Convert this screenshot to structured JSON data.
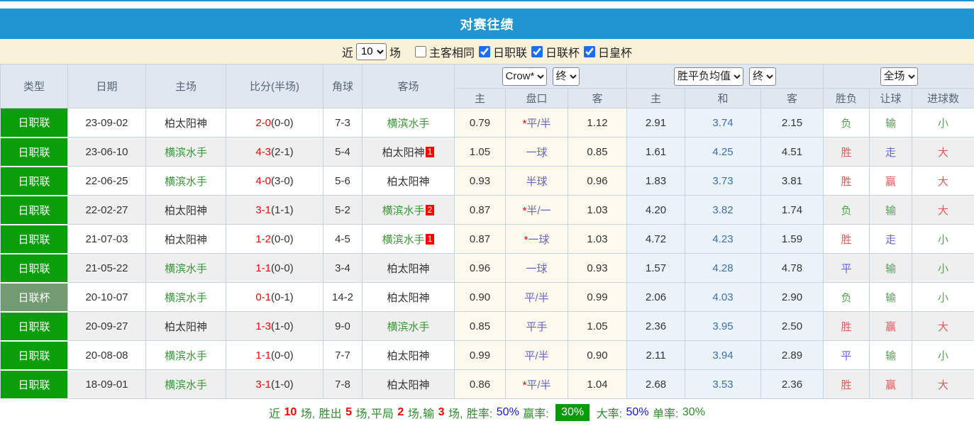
{
  "title": "对赛往绩",
  "filter": {
    "recent_label": "近",
    "recent_value": "10",
    "games_label": "场",
    "same_hva_label": "主客相同",
    "leagues": [
      "日职联",
      "日联杯",
      "日皇杯"
    ]
  },
  "header": {
    "col_type": "类型",
    "col_date": "日期",
    "col_home": "主场",
    "col_score": "比分(半场)",
    "col_corner": "角球",
    "col_away": "客场",
    "odds_select": "Crow*",
    "odds_state_select": "终",
    "mean_select": "胜平负均值",
    "mean_state_select": "终",
    "result_select": "全场",
    "sub": {
      "home": "主",
      "handicap": "盘口",
      "away": "客",
      "mean_home": "主",
      "mean_draw": "和",
      "mean_away": "客",
      "wl": "胜负",
      "hcp_result": "让球",
      "goals": "进球数"
    }
  },
  "rows": [
    {
      "league": "日职联",
      "league_c": "j1",
      "date": "23-09-02",
      "home": "柏太阳神",
      "home_c": "dark",
      "home_card": "",
      "score": "2-0",
      "half": "(0-0)",
      "corner": "7-3",
      "away": "横滨水手",
      "away_c": "green",
      "away_card": "",
      "odd_home": "0.79",
      "star": "*",
      "handicap": "平/半",
      "odd_away": "1.12",
      "mean_home": "2.91",
      "mean_draw": "3.74",
      "mean_away": "2.15",
      "wl": "负",
      "wl_c": "g",
      "hcp": "输",
      "hcp_c": "g",
      "goal": "小",
      "goal_c": "g"
    },
    {
      "league": "日职联",
      "league_c": "j1",
      "date": "23-06-10",
      "home": "横滨水手",
      "home_c": "green",
      "home_card": "",
      "score": "4-3",
      "half": "(2-1)",
      "corner": "5-4",
      "away": "柏太阳神",
      "away_c": "dark",
      "away_card": "1",
      "odd_home": "1.05",
      "star": "",
      "handicap": "一球",
      "odd_away": "0.85",
      "mean_home": "1.61",
      "mean_draw": "4.25",
      "mean_away": "4.51",
      "wl": "胜",
      "wl_c": "r",
      "hcp": "走",
      "hcp_c": "b",
      "goal": "大",
      "goal_c": "r"
    },
    {
      "league": "日职联",
      "league_c": "j1",
      "date": "22-06-25",
      "home": "横滨水手",
      "home_c": "green",
      "home_card": "",
      "score": "4-0",
      "half": "(3-0)",
      "corner": "5-6",
      "away": "柏太阳神",
      "away_c": "dark",
      "away_card": "",
      "odd_home": "0.93",
      "star": "",
      "handicap": "半球",
      "odd_away": "0.96",
      "mean_home": "1.83",
      "mean_draw": "3.73",
      "mean_away": "3.81",
      "wl": "胜",
      "wl_c": "r",
      "hcp": "赢",
      "hcp_c": "r",
      "goal": "大",
      "goal_c": "r"
    },
    {
      "league": "日职联",
      "league_c": "j1",
      "date": "22-02-27",
      "home": "柏太阳神",
      "home_c": "dark",
      "home_card": "",
      "score": "3-1",
      "half": "(1-1)",
      "corner": "5-2",
      "away": "横滨水手",
      "away_c": "green",
      "away_card": "2",
      "odd_home": "0.87",
      "star": "*",
      "handicap": "半/一",
      "odd_away": "1.03",
      "mean_home": "4.20",
      "mean_draw": "3.82",
      "mean_away": "1.74",
      "wl": "负",
      "wl_c": "g",
      "hcp": "输",
      "hcp_c": "g",
      "goal": "大",
      "goal_c": "r"
    },
    {
      "league": "日职联",
      "league_c": "j1",
      "date": "21-07-03",
      "home": "柏太阳神",
      "home_c": "dark",
      "home_card": "",
      "score": "1-2",
      "half": "(0-0)",
      "corner": "4-5",
      "away": "横滨水手",
      "away_c": "green",
      "away_card": "1",
      "odd_home": "0.87",
      "star": "*",
      "handicap": "一球",
      "odd_away": "1.03",
      "mean_home": "4.72",
      "mean_draw": "4.23",
      "mean_away": "1.59",
      "wl": "胜",
      "wl_c": "r",
      "hcp": "走",
      "hcp_c": "b",
      "goal": "小",
      "goal_c": "g"
    },
    {
      "league": "日职联",
      "league_c": "j1",
      "date": "21-05-22",
      "home": "横滨水手",
      "home_c": "green",
      "home_card": "",
      "score": "1-1",
      "half": "(0-0)",
      "corner": "3-4",
      "away": "柏太阳神",
      "away_c": "dark",
      "away_card": "",
      "odd_home": "0.96",
      "star": "",
      "handicap": "一球",
      "odd_away": "0.93",
      "mean_home": "1.57",
      "mean_draw": "4.28",
      "mean_away": "4.78",
      "wl": "平",
      "wl_c": "b",
      "hcp": "输",
      "hcp_c": "g",
      "goal": "小",
      "goal_c": "g"
    },
    {
      "league": "日联杯",
      "league_c": "cup",
      "date": "20-10-07",
      "home": "横滨水手",
      "home_c": "green",
      "home_card": "",
      "score": "0-1",
      "half": "(0-1)",
      "corner": "14-2",
      "away": "柏太阳神",
      "away_c": "dark",
      "away_card": "",
      "odd_home": "0.90",
      "star": "",
      "handicap": "平/半",
      "odd_away": "0.99",
      "mean_home": "2.06",
      "mean_draw": "4.03",
      "mean_away": "2.90",
      "wl": "负",
      "wl_c": "g",
      "hcp": "输",
      "hcp_c": "g",
      "goal": "小",
      "goal_c": "g"
    },
    {
      "league": "日职联",
      "league_c": "j1",
      "date": "20-09-27",
      "home": "柏太阳神",
      "home_c": "dark",
      "home_card": "",
      "score": "1-3",
      "half": "(1-0)",
      "corner": "9-0",
      "away": "横滨水手",
      "away_c": "green",
      "away_card": "",
      "odd_home": "0.85",
      "star": "",
      "handicap": "平手",
      "odd_away": "1.05",
      "mean_home": "2.36",
      "mean_draw": "3.95",
      "mean_away": "2.50",
      "wl": "胜",
      "wl_c": "r",
      "hcp": "赢",
      "hcp_c": "r",
      "goal": "大",
      "goal_c": "r"
    },
    {
      "league": "日职联",
      "league_c": "j1",
      "date": "20-08-08",
      "home": "横滨水手",
      "home_c": "green",
      "home_card": "",
      "score": "1-1",
      "half": "(0-0)",
      "corner": "7-7",
      "away": "柏太阳神",
      "away_c": "dark",
      "away_card": "",
      "odd_home": "0.99",
      "star": "",
      "handicap": "平/半",
      "odd_away": "0.90",
      "mean_home": "2.11",
      "mean_draw": "3.94",
      "mean_away": "2.89",
      "wl": "平",
      "wl_c": "b",
      "hcp": "输",
      "hcp_c": "g",
      "goal": "小",
      "goal_c": "g"
    },
    {
      "league": "日职联",
      "league_c": "j1",
      "date": "18-09-01",
      "home": "横滨水手",
      "home_c": "green",
      "home_card": "",
      "score": "3-1",
      "half": "(1-0)",
      "corner": "7-8",
      "away": "柏太阳神",
      "away_c": "dark",
      "away_card": "",
      "odd_home": "0.86",
      "star": "*",
      "handicap": "平/半",
      "odd_away": "1.04",
      "mean_home": "2.68",
      "mean_draw": "3.53",
      "mean_away": "2.36",
      "wl": "胜",
      "wl_c": "r",
      "hcp": "赢",
      "hcp_c": "r",
      "goal": "大",
      "goal_c": "r"
    }
  ],
  "footer": {
    "segments": [
      {
        "t": "近 ",
        "c": "g"
      },
      {
        "t": "10",
        "c": "r"
      },
      {
        "t": " 场, ",
        "c": "g"
      },
      {
        "t": "胜出 ",
        "c": "g"
      },
      {
        "t": "5",
        "c": "r"
      },
      {
        "t": " 场,",
        "c": "g"
      },
      {
        "t": "平局 ",
        "c": "g"
      },
      {
        "t": "2",
        "c": "r"
      },
      {
        "t": " 场,",
        "c": "g"
      },
      {
        "t": "输 ",
        "c": "g"
      },
      {
        "t": "3",
        "c": "r"
      },
      {
        "t": " 场, ",
        "c": "g"
      },
      {
        "t": "胜率: ",
        "c": "g"
      },
      {
        "t": "50%",
        "c": "bl"
      },
      {
        "t": " 赢率: ",
        "c": "g"
      },
      {
        "t": "30%",
        "c": "badge"
      },
      {
        "t": " 大率: ",
        "c": "g"
      },
      {
        "t": "50%",
        "c": "bl"
      },
      {
        "t": " 单率: ",
        "c": "g"
      },
      {
        "t": "30%",
        "c": "gv"
      }
    ]
  }
}
